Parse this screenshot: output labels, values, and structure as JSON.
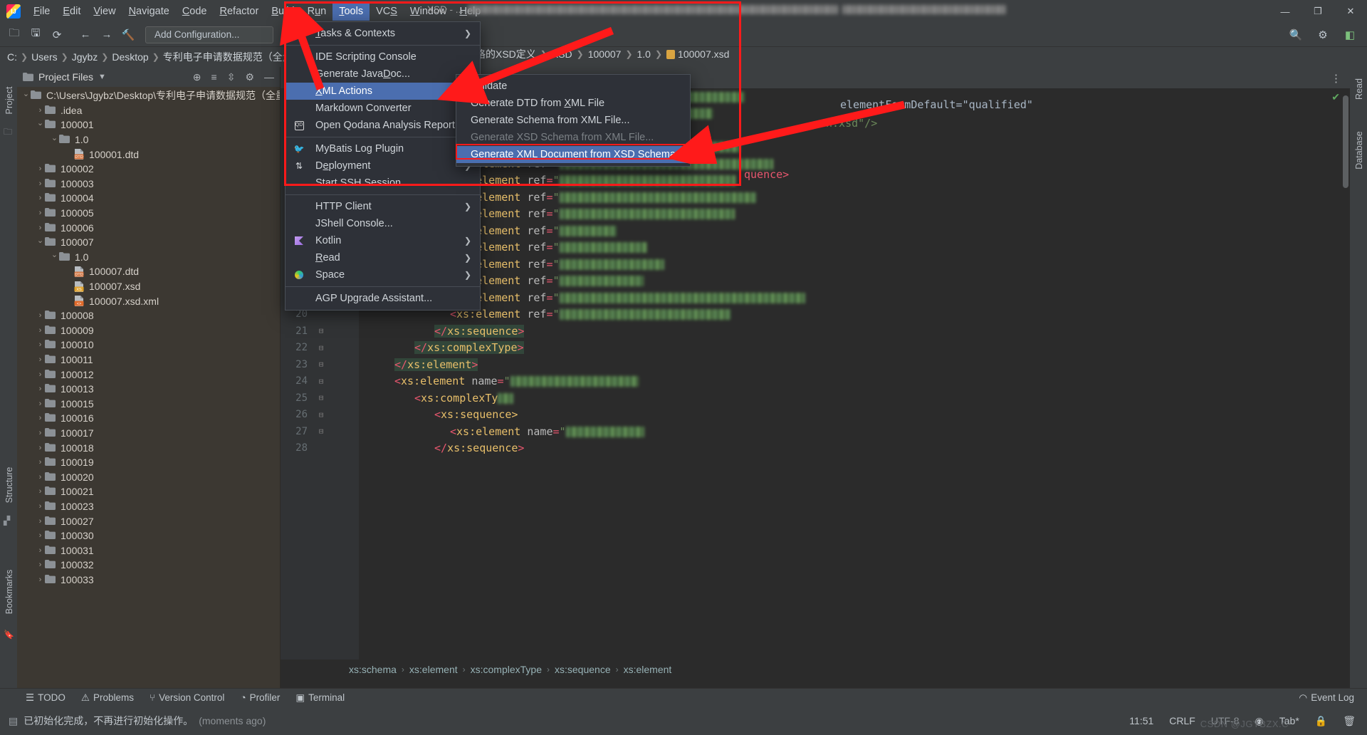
{
  "window": {
    "app_icon": "intellij-idea-logo",
    "title_prefix": "XSD - ...",
    "menus": [
      {
        "label": "File",
        "mnemonic": "F"
      },
      {
        "label": "Edit",
        "mnemonic": "E"
      },
      {
        "label": "View",
        "mnemonic": "V"
      },
      {
        "label": "Navigate",
        "mnemonic": "N"
      },
      {
        "label": "Code",
        "mnemonic": "C"
      },
      {
        "label": "Refactor",
        "mnemonic": "R"
      },
      {
        "label": "Build",
        "mnemonic": "B"
      },
      {
        "label": "Run",
        "mnemonic": "u"
      },
      {
        "label": "Tools",
        "mnemonic": "T",
        "active": true
      },
      {
        "label": "VCS",
        "mnemonic": "S"
      },
      {
        "label": "Window",
        "mnemonic": "W"
      },
      {
        "label": "Help",
        "mnemonic": "H"
      }
    ],
    "controls": {
      "minimize": "—",
      "maximize": "❐",
      "close": "✕"
    }
  },
  "toolbar": {
    "add_configuration": "Add Configuration...",
    "icons": [
      "open-folder-icon",
      "save-icon",
      "sync-icon",
      "back-arrow-icon",
      "forward-arrow-icon",
      "build-hammer-icon",
      "run-icon",
      "debug-icon"
    ],
    "right_icons": [
      "search-icon",
      "settings-gear-icon",
      "plugin-icon"
    ]
  },
  "pathbar": {
    "crumbs": [
      "C:",
      "Users",
      "Jgybz",
      "Desktop",
      "专利电子申请数据规范（全量）"
    ]
  },
  "project": {
    "panel_title": "Project Files",
    "header_icons": [
      "locate-icon",
      "expand-all-icon",
      "collapse-all-icon",
      "settings-gear-icon",
      "hide-icon",
      "more-icon"
    ],
    "root": "C:\\Users\\Jgybz\\Desktop\\专利电子申请数据规范（全量）",
    "tree": [
      {
        "label": ".idea",
        "type": "folder",
        "depth": 1,
        "state": "closed"
      },
      {
        "label": "100001",
        "type": "folder",
        "depth": 1,
        "state": "open"
      },
      {
        "label": "1.0",
        "type": "folder",
        "depth": 2,
        "state": "open"
      },
      {
        "label": "100001.dtd",
        "type": "dtd",
        "depth": 3,
        "state": "leaf"
      },
      {
        "label": "100002",
        "type": "folder",
        "depth": 1,
        "state": "closed"
      },
      {
        "label": "100003",
        "type": "folder",
        "depth": 1,
        "state": "closed"
      },
      {
        "label": "100004",
        "type": "folder",
        "depth": 1,
        "state": "closed"
      },
      {
        "label": "100005",
        "type": "folder",
        "depth": 1,
        "state": "closed"
      },
      {
        "label": "100006",
        "type": "folder",
        "depth": 1,
        "state": "closed"
      },
      {
        "label": "100007",
        "type": "folder",
        "depth": 1,
        "state": "open"
      },
      {
        "label": "1.0",
        "type": "folder",
        "depth": 2,
        "state": "open"
      },
      {
        "label": "100007.dtd",
        "type": "dtd",
        "depth": 3,
        "state": "leaf"
      },
      {
        "label": "100007.xsd",
        "type": "xsd",
        "depth": 3,
        "state": "leaf"
      },
      {
        "label": "100007.xsd.xml",
        "type": "xml",
        "depth": 3,
        "state": "leaf"
      },
      {
        "label": "100008",
        "type": "folder",
        "depth": 1,
        "state": "closed"
      },
      {
        "label": "100009",
        "type": "folder",
        "depth": 1,
        "state": "closed"
      },
      {
        "label": "100010",
        "type": "folder",
        "depth": 1,
        "state": "closed"
      },
      {
        "label": "100011",
        "type": "folder",
        "depth": 1,
        "state": "closed"
      },
      {
        "label": "100012",
        "type": "folder",
        "depth": 1,
        "state": "closed"
      },
      {
        "label": "100013",
        "type": "folder",
        "depth": 1,
        "state": "closed"
      },
      {
        "label": "100015",
        "type": "folder",
        "depth": 1,
        "state": "closed"
      },
      {
        "label": "100016",
        "type": "folder",
        "depth": 1,
        "state": "closed"
      },
      {
        "label": "100017",
        "type": "folder",
        "depth": 1,
        "state": "closed"
      },
      {
        "label": "100018",
        "type": "folder",
        "depth": 1,
        "state": "closed"
      },
      {
        "label": "100019",
        "type": "folder",
        "depth": 1,
        "state": "closed"
      },
      {
        "label": "100020",
        "type": "folder",
        "depth": 1,
        "state": "closed"
      },
      {
        "label": "100021",
        "type": "folder",
        "depth": 1,
        "state": "closed"
      },
      {
        "label": "100023",
        "type": "folder",
        "depth": 1,
        "state": "closed"
      },
      {
        "label": "100027",
        "type": "folder",
        "depth": 1,
        "state": "closed"
      },
      {
        "label": "100030",
        "type": "folder",
        "depth": 1,
        "state": "closed"
      },
      {
        "label": "100031",
        "type": "folder",
        "depth": 1,
        "state": "closed"
      },
      {
        "label": "100032",
        "type": "folder",
        "depth": 1,
        "state": "closed"
      },
      {
        "label": "100033",
        "type": "folder",
        "depth": 1,
        "state": "closed"
      }
    ]
  },
  "left_strip": {
    "labels": [
      "Project",
      "Structure",
      "Bookmarks"
    ]
  },
  "right_strip": {
    "labels": [
      "Read",
      "Database"
    ]
  },
  "editor": {
    "file_breadcrumb": [
      "式表格的XSD定义",
      "XSD",
      "100007",
      "1.0",
      "100007.xsd"
    ],
    "partial_code_top": "elementFormDefault=\"qualified\"",
    "partial_code_top2": "n.xsd\"/>",
    "partial_code_top3": "quence>",
    "lines": [
      {
        "num": "",
        "indent": 0,
        "fold": "",
        "content": "<xs:element ref=\"",
        "blur": 260
      },
      {
        "num": "",
        "indent": 0,
        "fold": "",
        "content": "<xs:element ref=\"",
        "blur": 215
      },
      {
        "num": "",
        "indent": 0,
        "fold": "",
        "content": "<xs:element ref=\"",
        "blur": 172
      },
      {
        "num": "",
        "indent": 0,
        "fold": "",
        "content": "<xs:element ref=\"",
        "blur": 253
      },
      {
        "num": "",
        "indent": 0,
        "fold": "",
        "content": "<xs:element ref=\"",
        "blur": 300
      },
      {
        "num": "",
        "indent": 0,
        "fold": "",
        "content": "<xs:element ref=\"",
        "blur": 247
      },
      {
        "num": "13",
        "indent": 0,
        "fold": "",
        "content": "<xs:element ref=\"",
        "blur": 276
      },
      {
        "num": "14",
        "indent": 0,
        "fold": "",
        "content": "<xs:element ref=\"",
        "blur": 246
      },
      {
        "num": "15",
        "indent": 0,
        "fold": "",
        "content": "<xs:element ref=\"",
        "blur": 80
      },
      {
        "num": "16",
        "indent": 0,
        "fold": "",
        "content": "<xs:element ref=\"",
        "blur": 123
      },
      {
        "num": "17",
        "indent": 0,
        "fold": "",
        "content": "<xs:element ref=\"",
        "blur": 147
      },
      {
        "num": "18",
        "indent": 0,
        "fold": "",
        "content": "<xs:element ref=\"",
        "blur": 118
      },
      {
        "num": "19",
        "indent": 0,
        "fold": "",
        "content": "<xs:element ref=\"",
        "blur": 345
      },
      {
        "num": "20",
        "indent": 0,
        "fold": "",
        "content": "<xs:element ref=\"",
        "blur": 240
      },
      {
        "num": "21",
        "indent": 0,
        "fold": "fold",
        "content": "</xs:sequence>",
        "blur": 0,
        "hl": true
      },
      {
        "num": "22",
        "indent": 0,
        "fold": "fold",
        "content": "</xs:complexType>",
        "blur": 0,
        "hl": true
      },
      {
        "num": "23",
        "indent": 0,
        "fold": "fold",
        "content": "</xs:element>",
        "blur": 0,
        "hl": true
      },
      {
        "num": "24",
        "indent": 0,
        "fold": "fold",
        "content": "<xs:element name=\"",
        "blur": 180
      },
      {
        "num": "25",
        "indent": 0,
        "fold": "fold",
        "content": "<xs:complexTy",
        "blur": 22
      },
      {
        "num": "26",
        "indent": 0,
        "fold": "fold",
        "content": "<xs:sequence>",
        "blur": 0
      },
      {
        "num": "27",
        "indent": 0,
        "fold": "fold",
        "content": "<xs:element name=\"",
        "blur": 110
      },
      {
        "num": "28",
        "indent": 0,
        "fold": "",
        "content": "</xs:sequence>",
        "blur": 0
      }
    ],
    "structure_breadcrumb": [
      "xs:schema",
      "xs:element",
      "xs:complexType",
      "xs:sequence",
      "xs:element"
    ]
  },
  "tools_menu": {
    "items": [
      {
        "label": "Tasks & Contexts",
        "mnemonic": "T",
        "submenu": true,
        "icon": ""
      },
      {
        "sep": true
      },
      {
        "label": "IDE Scripting Console",
        "icon": ""
      },
      {
        "label": "Generate JavaDoc...",
        "mnemonic": "D",
        "icon": ""
      },
      {
        "label": "XML Actions",
        "mnemonic": "X",
        "submenu": true,
        "selected": true,
        "icon": ""
      },
      {
        "label": "Markdown Converter",
        "submenu": true,
        "icon": ""
      },
      {
        "label": "Open Qodana Analysis Report...",
        "icon": "qodana-icon"
      },
      {
        "sep": true
      },
      {
        "label": "MyBatis Log Plugin",
        "icon": "mybatis-icon"
      },
      {
        "label": "Deployment",
        "mnemonic": "e",
        "submenu": true,
        "icon": "deployment-icon"
      },
      {
        "label": "Start SSH Session...",
        "icon": ""
      },
      {
        "sep": true
      },
      {
        "label": "HTTP Client",
        "submenu": true,
        "icon": ""
      },
      {
        "label": "JShell Console...",
        "icon": ""
      },
      {
        "label": "Kotlin",
        "submenu": true,
        "icon": "kotlin-icon"
      },
      {
        "label": "Read",
        "mnemonic": "R",
        "submenu": true,
        "icon": ""
      },
      {
        "label": "Space",
        "submenu": true,
        "icon": "space-icon"
      },
      {
        "sep": true
      },
      {
        "label": "AGP Upgrade Assistant...",
        "icon": ""
      }
    ]
  },
  "xml_actions_submenu": {
    "items": [
      {
        "label": "Validate",
        "mnemonic": "V"
      },
      {
        "label": "Generate DTD from XML File",
        "mnemonic": "X"
      },
      {
        "label": "Generate Schema from XML File..."
      },
      {
        "label": "Generate XSD Schema from XML File...",
        "disabled": true
      },
      {
        "label": "Generate XML Document from XSD Schema...",
        "selected": true
      }
    ]
  },
  "bottom_bar": {
    "items": [
      {
        "label": "TODO",
        "icon": "todo-icon"
      },
      {
        "label": "Problems",
        "icon": "problems-icon"
      },
      {
        "label": "Version Control",
        "icon": "branch-icon"
      },
      {
        "label": "Profiler",
        "icon": "profiler-icon"
      },
      {
        "label": "Terminal",
        "icon": "terminal-icon"
      }
    ],
    "event_log": "Event Log"
  },
  "status_bar": {
    "message": "已初始化完成，不再进行初始化操作。",
    "message_time": "(moments ago)",
    "time": "11:51",
    "line_sep": "CRLF",
    "encoding": "UTF-8",
    "indent": "Tab*",
    "lock_icon": "lock-icon",
    "watermark": "CSDN @JGYBZX.C"
  },
  "colors": {
    "accent": "#4b6eaf",
    "annotation_red": "#ff1a1a",
    "panel_bg": "#3c3832",
    "editor_bg": "#2b2b2b",
    "chrome_bg": "#3c3f41"
  }
}
